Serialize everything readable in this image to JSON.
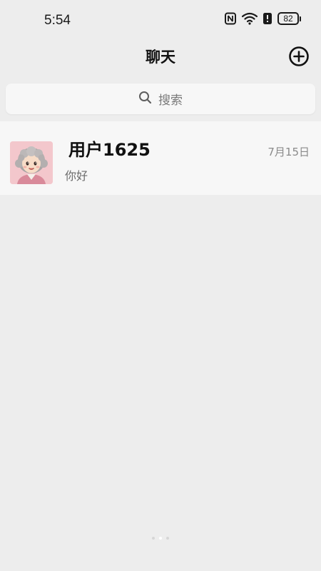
{
  "status_bar": {
    "time": "5:54",
    "battery": "82",
    "icons": [
      "nfc-icon",
      "wifi-icon",
      "alert-icon",
      "battery-icon"
    ]
  },
  "header": {
    "title": "聊天",
    "add_icon": "plus-circle-icon"
  },
  "search": {
    "placeholder": "搜索",
    "icon": "search-icon"
  },
  "chats": [
    {
      "name": "用户1625",
      "preview": "你好",
      "time": "7月15日",
      "avatar": "grandma-avatar"
    }
  ],
  "colors": {
    "background": "#ededed",
    "card": "#f7f7f7",
    "title_text": "#111111",
    "secondary_text": "#8a8a8a"
  }
}
